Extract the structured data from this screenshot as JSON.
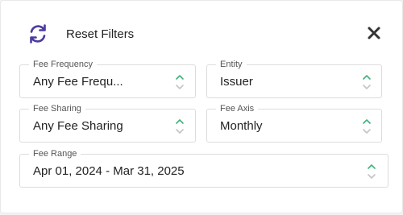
{
  "header": {
    "reset_label": "Reset Filters",
    "reset_icon": "refresh-icon",
    "close_icon": "close-icon"
  },
  "filters": {
    "fee_frequency": {
      "label": "Fee Frequency",
      "value": "Any Fee Frequ..."
    },
    "entity": {
      "label": "Entity",
      "value": "Issuer"
    },
    "fee_sharing": {
      "label": "Fee Sharing",
      "value": "Any Fee Sharing"
    },
    "fee_axis": {
      "label": "Fee Axis",
      "value": "Monthly"
    },
    "fee_range": {
      "label": "Fee Range",
      "value": "Apr 01, 2024 - Mar 31, 2025"
    }
  },
  "colors": {
    "refresh_icon": "#4b3ba0",
    "chevron_up": "#3db37a",
    "chevron_down": "#c4c4c4",
    "close_icon": "#333333"
  }
}
